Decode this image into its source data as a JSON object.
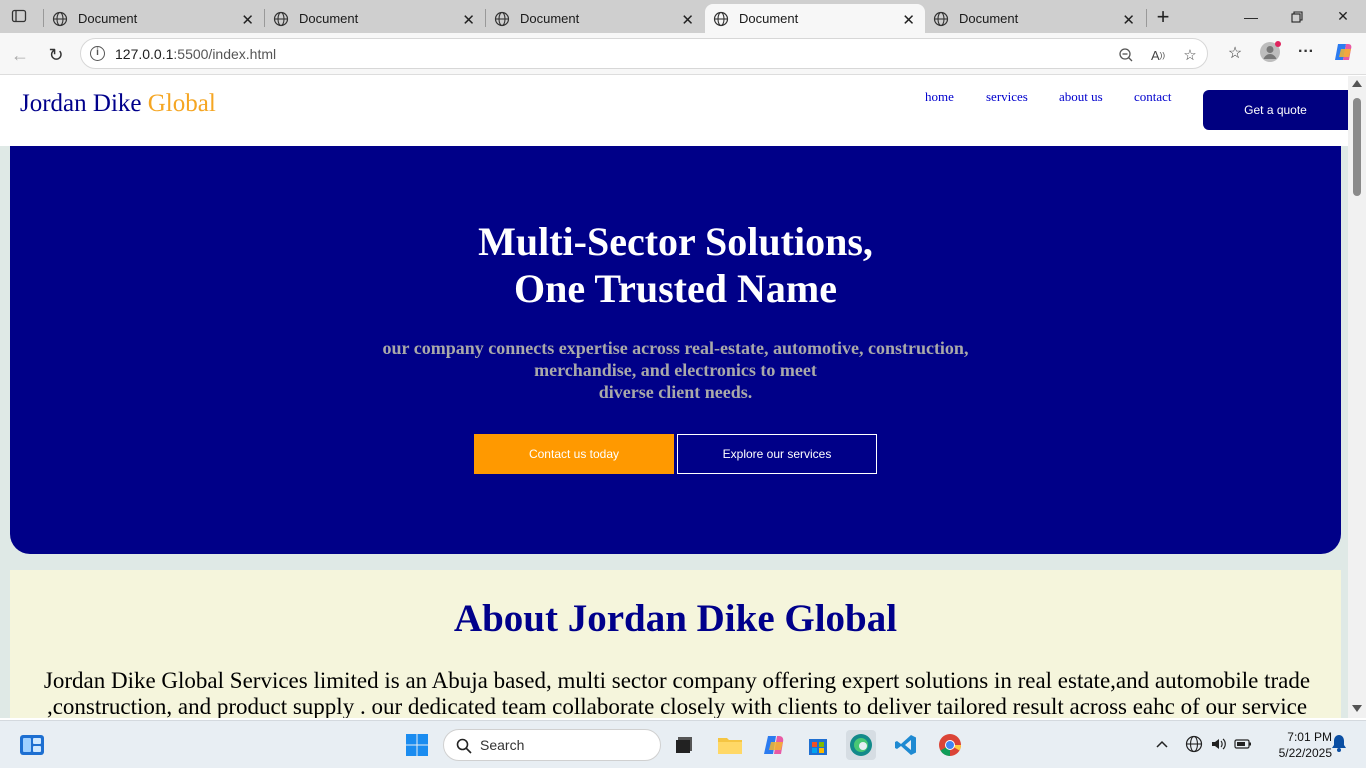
{
  "browser": {
    "tabs": [
      {
        "title": "Document",
        "active": false
      },
      {
        "title": "Document",
        "active": false
      },
      {
        "title": "Document",
        "active": false
      },
      {
        "title": "Document",
        "active": true
      },
      {
        "title": "Document",
        "active": false
      }
    ],
    "url_host": "127.0.0.1",
    "url_rest": ":5500/index.html"
  },
  "site": {
    "logo_main": "Jordan Dike ",
    "logo_accent": "Global",
    "nav": [
      "home",
      "services",
      "about us",
      "contact"
    ],
    "quote_button": "Get a quote",
    "hero": {
      "title_line1": "Multi-Sector Solutions,",
      "title_line2": "One Trusted Name",
      "subtitle_line1": "our company connects expertise across real-estate, automotive, construction,",
      "subtitle_line2": "merchandise, and electronics to meet",
      "subtitle_line3": "diverse client needs.",
      "cta_primary": "Contact us today",
      "cta_secondary": "Explore our services"
    },
    "about": {
      "heading": "About Jordan Dike Global",
      "text": "Jordan Dike Global Services limited is an Abuja based, multi sector company offering expert solutions in real estate,and automobile trade ,construction, and product supply . our dedicated team collaborate closely with clients to deliver tailored result across eahc of our service"
    }
  },
  "taskbar": {
    "search_placeholder": "Search",
    "time": "7:01 PM",
    "date": "5/22/2025"
  },
  "colors": {
    "brand_navy": "#000088",
    "accent_orange": "#ff9900",
    "about_bg": "#f5f5dc"
  }
}
